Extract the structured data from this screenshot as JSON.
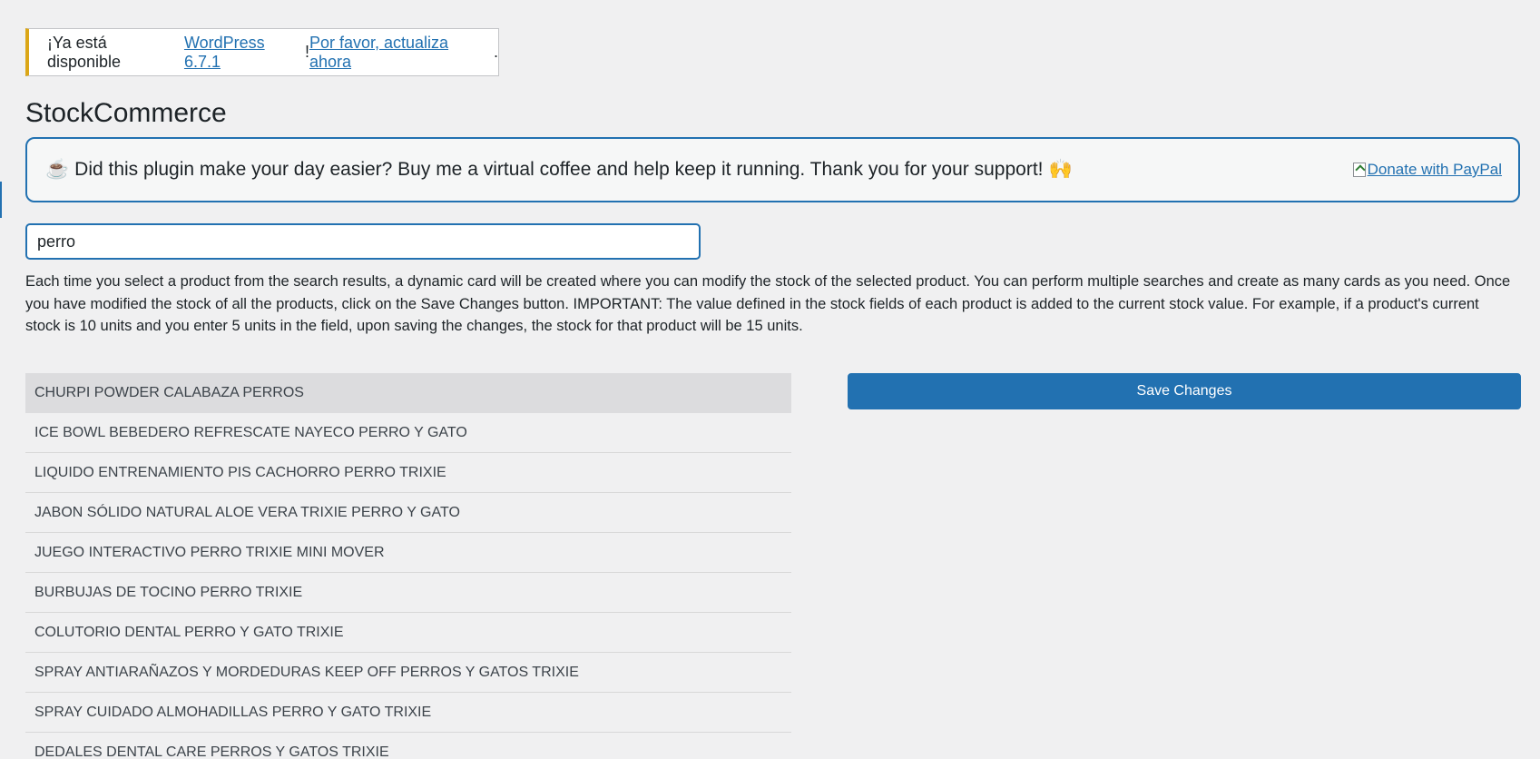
{
  "notice": {
    "prefix": "¡Ya está disponible ",
    "version_link": "WordPress 6.7.1",
    "middle": "! ",
    "update_link": "Por favor, actualiza ahora",
    "suffix": "."
  },
  "page_title": "StockCommerce",
  "donate": {
    "emoji_start": "☕",
    "message": "Did this plugin make your day easier? Buy me a virtual coffee and help keep it running. Thank you for your support!",
    "emoji_end": "🙌",
    "link_label": "Donate with PayPal"
  },
  "search": {
    "value": "perro"
  },
  "description": "Each time you select a product from the search results, a dynamic card will be created where you can modify the stock of the selected product. You can perform multiple searches and create as many cards as you need. Once you have modified the stock of all the products, click on the Save Changes button. IMPORTANT: The value defined in the stock fields of each product is added to the current stock value. For example, if a product's current stock is 10 units and you enter 5 units in the field, upon saving the changes, the stock for that product will be 15 units.",
  "results": [
    "CHURPI POWDER CALABAZA PERROS",
    "ICE BOWL BEBEDERO REFRESCATE NAYECO PERRO Y GATO",
    "LIQUIDO ENTRENAMIENTO PIS CACHORRO PERRO TRIXIE",
    "JABON SÓLIDO NATURAL ALOE VERA TRIXIE PERRO Y GATO",
    "JUEGO INTERACTIVO PERRO TRIXIE MINI MOVER",
    "BURBUJAS DE TOCINO PERRO TRIXIE",
    "COLUTORIO DENTAL PERRO Y GATO TRIXIE",
    "SPRAY ANTIARAÑAZOS Y MORDEDURAS KEEP OFF PERROS Y GATOS TRIXIE",
    "SPRAY CUIDADO ALMOHADILLAS PERRO Y GATO TRIXIE",
    "DEDALES DENTAL CARE PERROS Y GATOS TRIXIE"
  ],
  "save_button": "Save Changes",
  "colors": {
    "accent": "#2271b1",
    "notice_warning": "#dba617",
    "background": "#f0f0f1"
  }
}
